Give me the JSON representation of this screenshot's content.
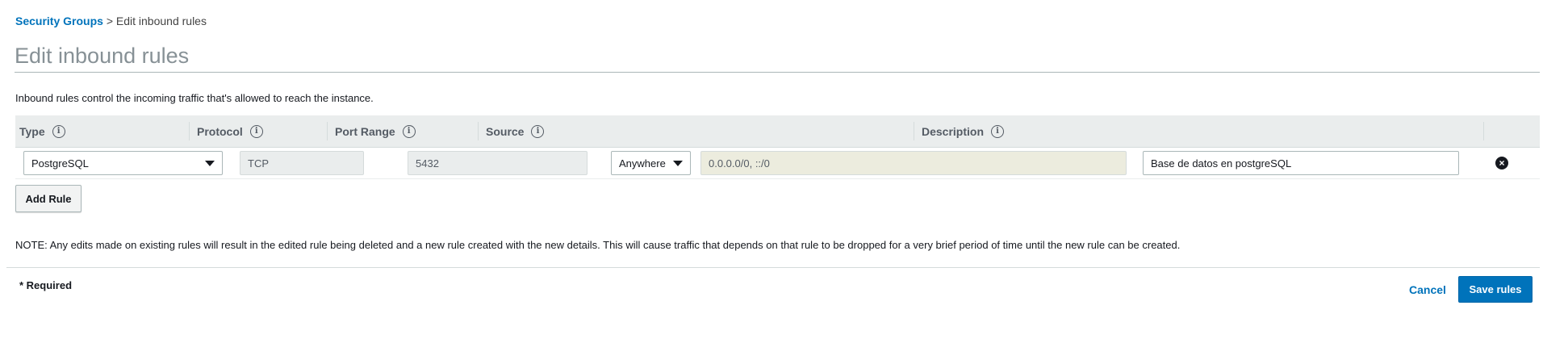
{
  "breadcrumb": {
    "parent": "Security Groups",
    "separator": ">",
    "current": "Edit inbound rules"
  },
  "page": {
    "title": "Edit inbound rules",
    "intro": "Inbound rules control the incoming traffic that's allowed to reach the instance."
  },
  "table": {
    "headers": {
      "type": "Type",
      "protocol": "Protocol",
      "port_range": "Port Range",
      "source": "Source",
      "description": "Description"
    },
    "info_glyph": "i",
    "rows": [
      {
        "type": "PostgreSQL",
        "protocol": "TCP",
        "port_range": "5432",
        "source_type": "Anywhere",
        "source_cidr": "0.0.0.0/0, ::/0",
        "description": "Base de datos en postgreSQL",
        "remove_glyph": "×"
      }
    ]
  },
  "actions": {
    "add_rule": "Add Rule",
    "cancel": "Cancel",
    "save": "Save rules"
  },
  "note": "NOTE: Any edits made on existing rules will result in the edited rule being deleted and a new rule created with the new details. This will cause traffic that depends on that rule to be dropped for a very brief period of time until the new rule can be created.",
  "required_label": "* Required",
  "icons": {
    "info": "info-icon",
    "remove": "remove-circle-icon",
    "dropdown": "caret-down-icon"
  },
  "colors": {
    "link": "#0073bb",
    "primary_button": "#0073bb",
    "header_bg": "#eaeded",
    "title": "#879196"
  }
}
